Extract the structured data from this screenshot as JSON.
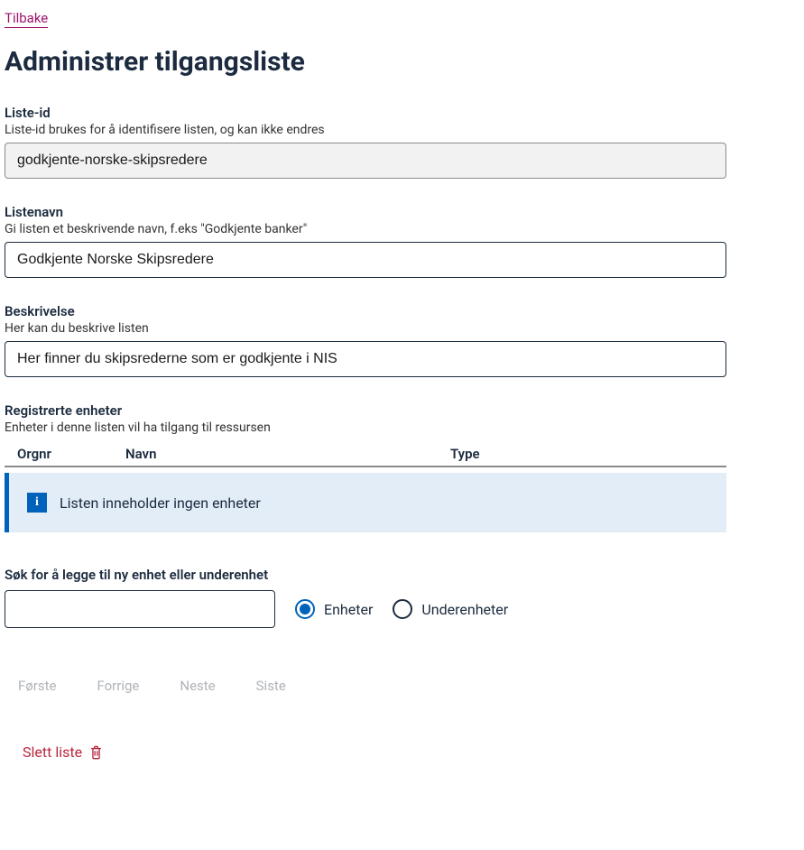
{
  "back_link": "Tilbake",
  "page_title": "Administrer tilgangsliste",
  "list_id": {
    "label": "Liste-id",
    "help": "Liste-id brukes for å identifisere listen, og kan ikke endres",
    "value": "godkjente-norske-skipsredere"
  },
  "list_name": {
    "label": "Listenavn",
    "help": "Gi listen et beskrivende navn, f.eks \"Godkjente banker\"",
    "value": "Godkjente Norske Skipsredere"
  },
  "description": {
    "label": "Beskrivelse",
    "help": "Her kan du beskrive listen",
    "value": "Her finner du skipsrederne som er godkjente i NIS"
  },
  "registered": {
    "label": "Registrerte enheter",
    "help": "Enheter i denne listen vil ha tilgang til ressursen",
    "columns": {
      "orgnr": "Orgnr",
      "navn": "Navn",
      "type": "Type"
    },
    "empty_message": "Listen inneholder ingen enheter"
  },
  "search": {
    "label": "Søk for å legge til ny enhet eller underenhet",
    "radio_enheter": "Enheter",
    "radio_underenheter": "Underenheter"
  },
  "pagination": {
    "first": "Første",
    "prev": "Forrige",
    "next": "Neste",
    "last": "Siste"
  },
  "delete": {
    "label": "Slett liste"
  }
}
